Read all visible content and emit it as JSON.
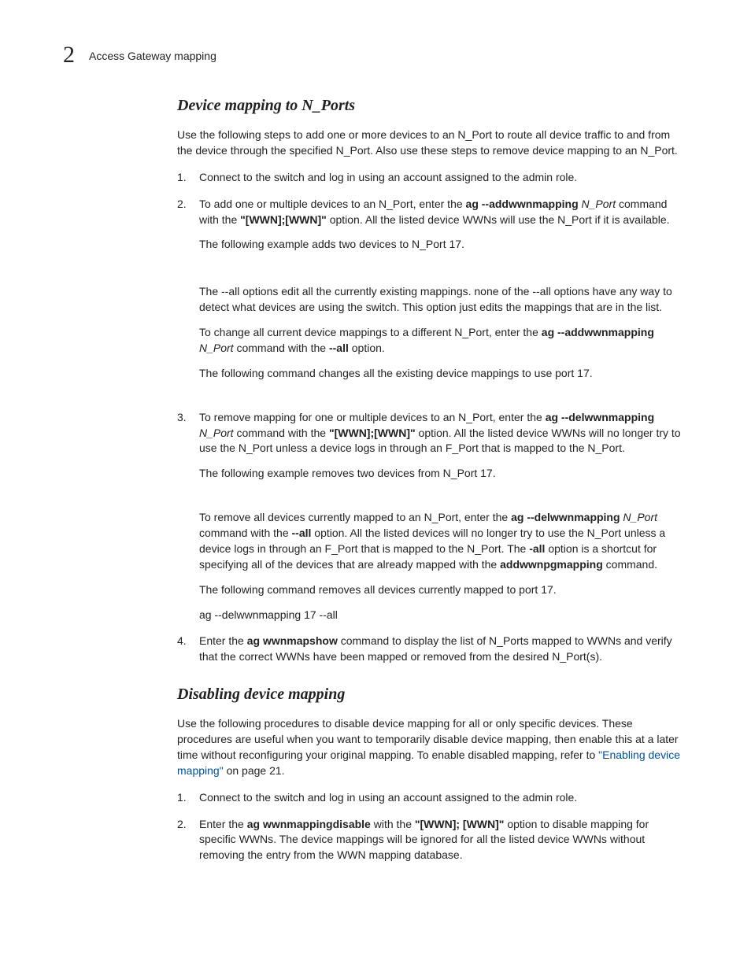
{
  "header": {
    "chapter_number": "2",
    "title": "Access Gateway mapping"
  },
  "sections": {
    "s1": {
      "title": "Device mapping to N_Ports",
      "intro": "Use the following steps to add one or more devices to an N_Port to route all device traffic to and from the device through the specified N_Port. Also use these steps to remove device mapping to an N_Port.",
      "step1": "Connect to the switch and log in using an account assigned to the admin role.",
      "step2": {
        "p1_a": "To add one or multiple devices to an N_Port, enter the ",
        "p1_cmd1": "ag --addwwnmapping",
        "p1_arg": " N_Port",
        "p1_b": " command with the ",
        "p1_opt": "\"[WWN];[WWN]\"",
        "p1_c": " option. All the listed device WWNs will use the N_Port if it is available.",
        "p2": "The following example adds two devices to N_Port 17.",
        "p3": "The --all options edit all the currently existing mappings. none of the --all options have any way to detect what devices are using the switch. This option just edits the mappings that are in the list.",
        "p4_a": "To change all current device mappings to a different N_Port, enter the ",
        "p4_cmd": "ag --addwwnmapping",
        "p4_arg": " N_Port",
        "p4_b": " command with the ",
        "p4_opt": "--all",
        "p4_c": " option.",
        "p5": "The following command changes all the existing device mappings to use port 17."
      },
      "step3": {
        "p1_a": "To remove mapping for one or multiple devices to an N_Port, enter the ",
        "p1_cmd": "ag --delwwnmapping",
        "p1_arg": " N_Port",
        "p1_b": " command with the ",
        "p1_opt": "\"[WWN];[WWN]\"",
        "p1_c": " option. All the listed device WWNs will no longer try to use the N_Port unless a device logs in through an F_Port that is mapped to the N_Port.",
        "p2": "The following example removes two devices from N_Port 17.",
        "p3_a": "To remove all devices currently mapped to an N_Port, enter the ",
        "p3_cmd": "ag --delwwnmapping",
        "p3_arg": " N_Port",
        "p3_b": " command with the ",
        "p3_opt1": "--all",
        "p3_c": " option. All the listed devices will no longer try to use the N_Port unless a device logs in through an F_Port that is mapped to the N_Port. The ",
        "p3_opt2": "-all",
        "p3_d": " option is a shortcut for specifying all of the devices that are already mapped with the ",
        "p3_cmd2": "addwwnpgmapping",
        "p3_e": " command.",
        "p4": "The following command removes all devices currently mapped to port 17.",
        "code": "ag --delwwnmapping 17 --all"
      },
      "step4": {
        "a": "Enter the ",
        "cmd1": "ag ",
        "cmd2": "wwnmapshow",
        "cmd_sep": "    ",
        "b": " command to display the list of N_Ports mapped to WWNs and verify that the correct WWNs have been mapped or removed from the desired N_Port(s)."
      }
    },
    "s2": {
      "title": "Disabling device mapping",
      "intro_a": "Use the following procedures to disable device mapping for all or only specific devices. These procedures are useful when you want to temporarily disable device mapping, then enable this at a later time without reconfiguring your original mapping. To enable disabled mapping, refer to ",
      "intro_link": "\"Enabling device mapping\"",
      "intro_b": " on page 21.",
      "step1": "Connect to the switch and log in using an account assigned to the admin role.",
      "step2": {
        "a": "Enter the ",
        "cmd1": "ag ",
        "cmd_sep": "    ",
        "cmd2": "wwnmappingdisable",
        "b": " with the ",
        "opt": "\"[WWN]; [WWN]\"",
        "c": " option to disable mapping for specific WWNs. The device mappings will be ignored for all the listed device WWNs without removing the entry from the WWN mapping database."
      }
    }
  }
}
